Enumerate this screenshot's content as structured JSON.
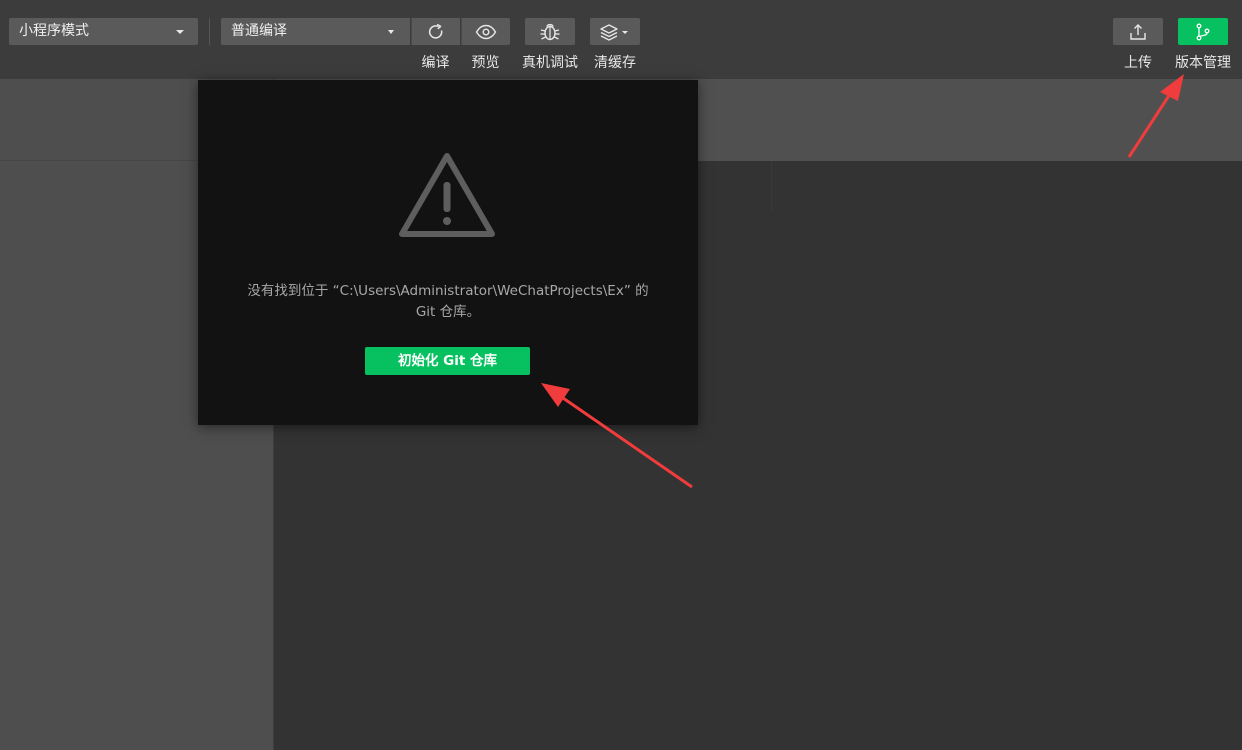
{
  "toolbar": {
    "mode_select": "小程序模式",
    "compile_select": "普通编译",
    "compile_label": "编译",
    "preview_label": "预览",
    "remote_debug_label": "真机调试",
    "clear_cache_label": "清缓存",
    "upload_label": "上传",
    "version_label": "版本管理"
  },
  "dialog": {
    "message_line1": "没有找到位于 “C:\\Users\\Administrator\\WeChatProjects\\Ex” 的",
    "message_line2": "Git 仓库。",
    "init_button": "初始化 Git 仓库"
  },
  "colors": {
    "accent": "#07c160",
    "annotation_arrow": "#f03c3c"
  },
  "icons": {
    "compile": "refresh-icon",
    "preview": "eye-icon",
    "remote_debug": "bug-icon",
    "clear_cache": "layers-icon",
    "upload": "upload-icon",
    "version": "branch-icon",
    "warning": "warning-triangle-icon"
  }
}
